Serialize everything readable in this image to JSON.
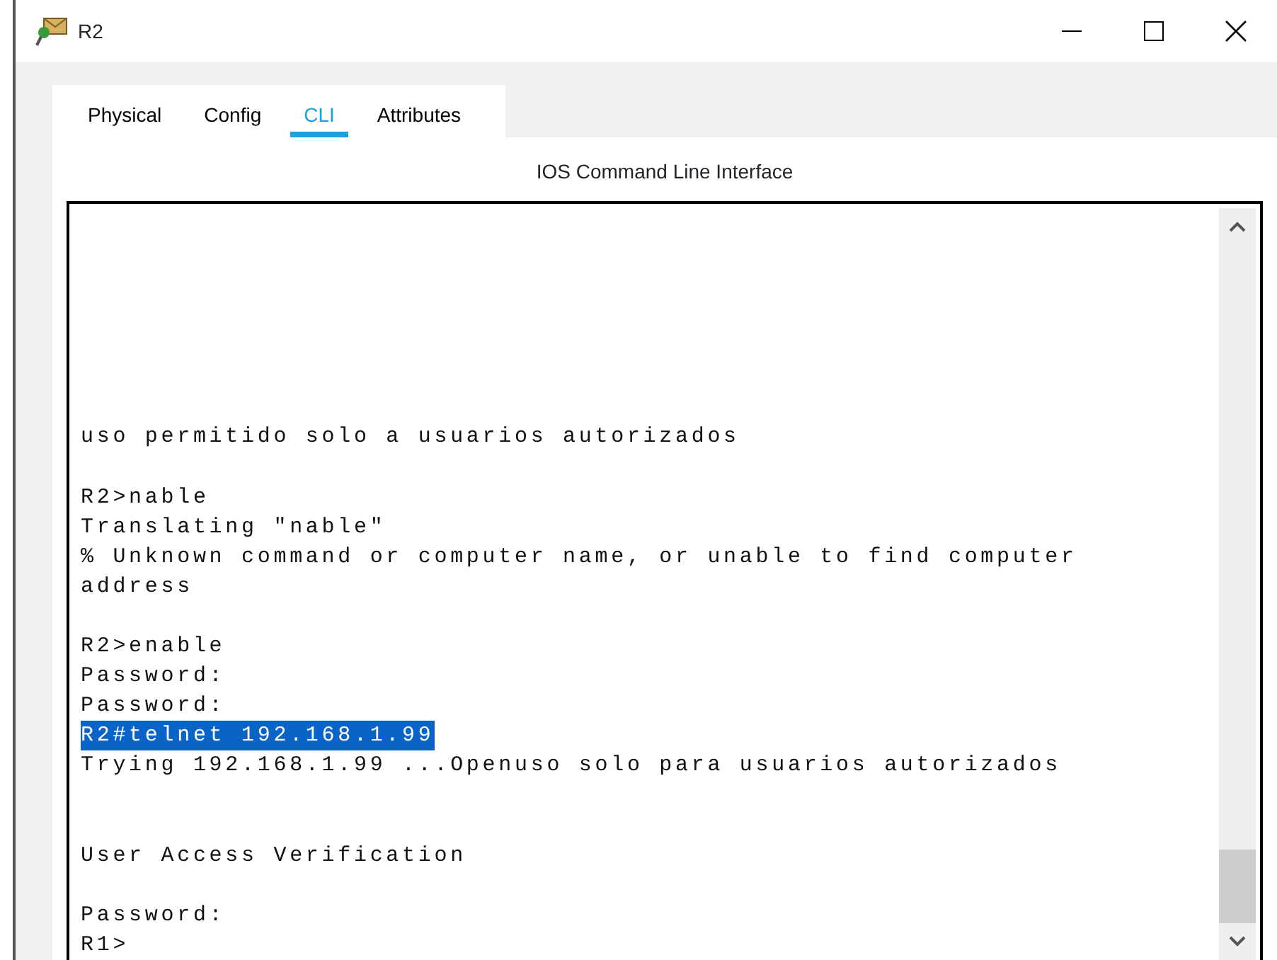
{
  "window": {
    "title": "R2"
  },
  "tabs": [
    {
      "label": "Physical",
      "selected": false
    },
    {
      "label": "Config",
      "selected": false
    },
    {
      "label": "CLI",
      "selected": true
    },
    {
      "label": "Attributes",
      "selected": false
    }
  ],
  "panel_title": "IOS Command Line Interface",
  "terminal": {
    "lines": [
      {
        "kind": "text",
        "text": "uso permitido solo a usuarios autorizados",
        "selected": false
      },
      {
        "kind": "blank"
      },
      {
        "kind": "text",
        "text": "R2>nable",
        "selected": false
      },
      {
        "kind": "text",
        "text": "Translating \"nable\"",
        "selected": false
      },
      {
        "kind": "text",
        "text": "% Unknown command or computer name, or unable to find computer",
        "selected": false
      },
      {
        "kind": "text",
        "text": "address",
        "selected": false
      },
      {
        "kind": "blank"
      },
      {
        "kind": "text",
        "text": "R2>enable",
        "selected": false
      },
      {
        "kind": "text",
        "text": "Password:",
        "selected": false
      },
      {
        "kind": "text",
        "text": "Password:",
        "selected": false
      },
      {
        "kind": "text",
        "text": "R2#telnet 192.168.1.99",
        "selected": true
      },
      {
        "kind": "text",
        "text": "Trying 192.168.1.99 ...Openuso solo para usuarios autorizados",
        "selected": false
      },
      {
        "kind": "blank"
      },
      {
        "kind": "blank"
      },
      {
        "kind": "text",
        "text": "User Access Verification",
        "selected": false
      },
      {
        "kind": "blank"
      },
      {
        "kind": "text",
        "text": "Password:",
        "selected": false
      },
      {
        "kind": "text",
        "text": "R1>",
        "selected": false
      }
    ]
  }
}
